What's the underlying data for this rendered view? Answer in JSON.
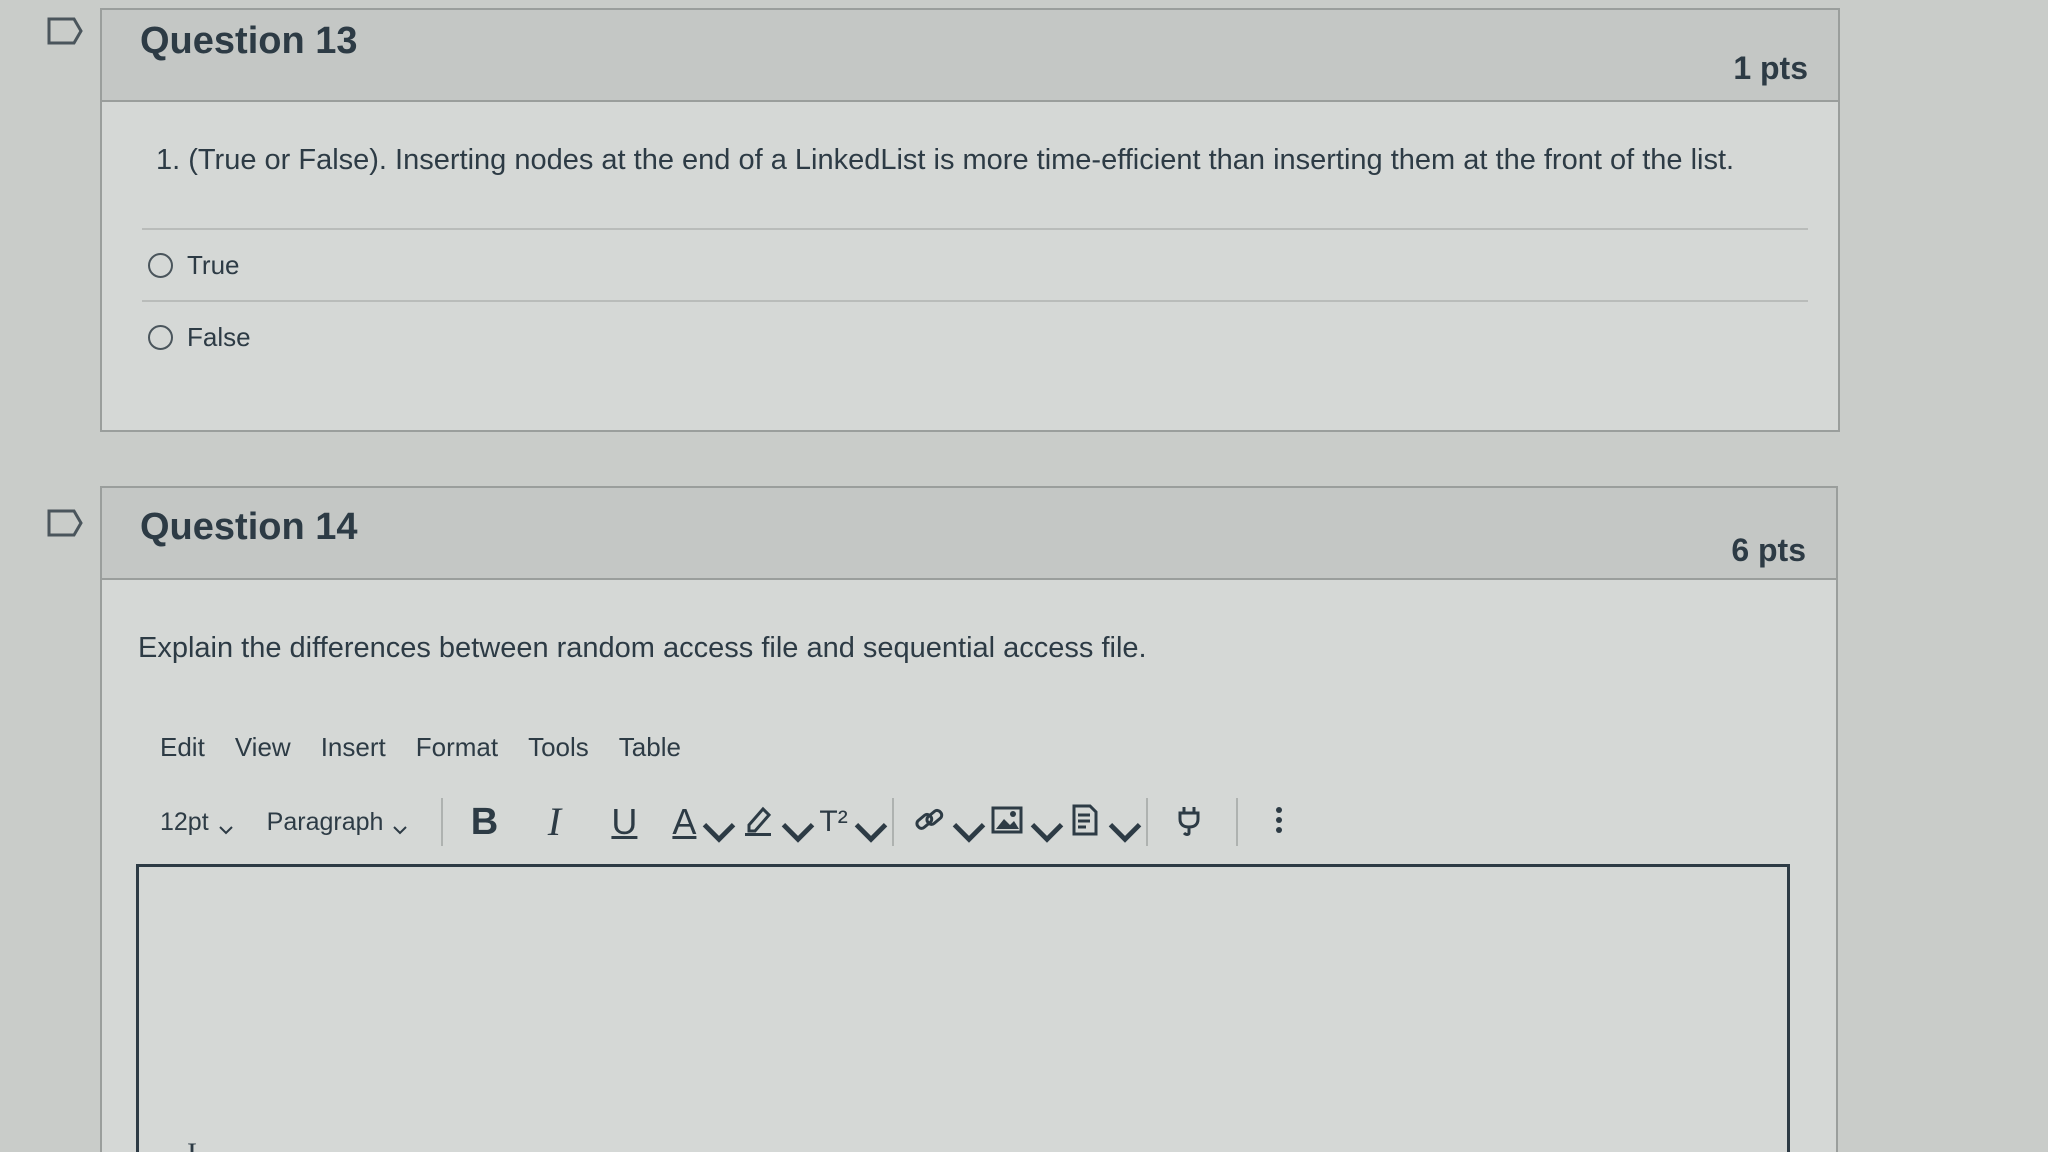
{
  "questions": [
    {
      "title": "Question 13",
      "points": "1 pts",
      "text": "1. (True or False). Inserting nodes at the end of a LinkedList is more time-efficient than inserting them at the front of the list.",
      "answers": [
        "True",
        "False"
      ]
    },
    {
      "title": "Question 14",
      "points": "6 pts",
      "text": "Explain the differences between random access file and sequential access file."
    }
  ],
  "editor": {
    "menu": [
      "Edit",
      "View",
      "Insert",
      "Format",
      "Tools",
      "Table"
    ],
    "font_size": "12pt",
    "block_format": "Paragraph",
    "toolbar_icons": [
      "bold-icon",
      "italic-icon",
      "underline-icon",
      "text-color-icon",
      "highlight-icon",
      "superscript-icon",
      "link-icon",
      "image-icon",
      "document-icon",
      "plugin-icon",
      "more-icon"
    ],
    "bold_glyph": "B",
    "italic_glyph": "I",
    "underline_glyph": "U",
    "text_color_glyph": "A",
    "superscript_glyph": "T²"
  },
  "colors": {
    "text": "#2d3b45",
    "background": "#d5d8d6",
    "header": "#c4c7c5"
  }
}
